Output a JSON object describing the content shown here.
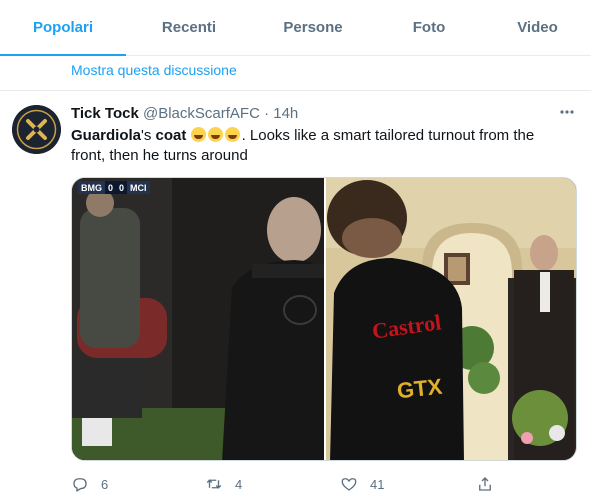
{
  "tabs": [
    {
      "label": "Popolari",
      "active": true
    },
    {
      "label": "Recenti",
      "active": false
    },
    {
      "label": "Persone",
      "active": false
    },
    {
      "label": "Foto",
      "active": false
    },
    {
      "label": "Video",
      "active": false
    }
  ],
  "thread": {
    "show_label": "Mostra questa discussione"
  },
  "tweet": {
    "display_name": "Tick Tock",
    "handle": "@BlackScarfAFC",
    "separator": "·",
    "time": "14h",
    "more_icon": "ellipsis-icon",
    "text": {
      "part1": "Guardiola",
      "part2": "'s ",
      "part3": "coat",
      "part4": ".  Looks like a smart tailored turnout from the front, then he turns around"
    },
    "emojis": [
      "laughing-tears-emoji",
      "laughing-tears-emoji",
      "laughing-tears-emoji"
    ],
    "media": {
      "scorebug": {
        "team1": "BMG",
        "score1": "0",
        "score2": "0",
        "team2": "MCI"
      },
      "left_image": "coach-back-photo",
      "right_image": "man-in-castrol-jacket-photo",
      "jacket_text_1": "Castrol",
      "jacket_text_2": "GTX"
    },
    "actions": {
      "reply": {
        "icon": "reply-icon",
        "count": "6"
      },
      "retweet": {
        "icon": "retweet-icon",
        "count": "4"
      },
      "like": {
        "icon": "heart-icon",
        "count": "41"
      },
      "share": {
        "icon": "share-icon"
      }
    }
  },
  "colors": {
    "accent": "#1da1f2",
    "muted": "#5b7083",
    "border": "#e6ecf0"
  }
}
